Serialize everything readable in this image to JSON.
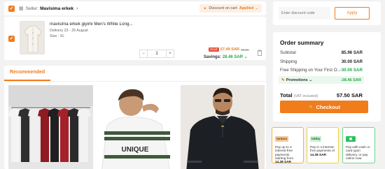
{
  "seller": {
    "label": "Seller:",
    "name": "Mavisima erkek",
    "discount_pill": {
      "text": "Discount on cart",
      "status": "Applied"
    }
  },
  "item": {
    "title": "mavisima erkek giyimi Men's White Long...",
    "delivery": "Delivery 23 - 25 August",
    "size": "Size : XL",
    "quantity": "1",
    "sale_badge": "SALE",
    "price_now": "57.49 SAR",
    "price_old": "85.96",
    "savings_label": "Savings:",
    "savings_value": "28.46 SAR"
  },
  "recommended": {
    "tab_label": "Recommended",
    "product3_print": "UNIQUE"
  },
  "coupon": {
    "placeholder": "Enter discount code",
    "apply_label": "Apply"
  },
  "summary": {
    "title": "Order summary",
    "rows": [
      {
        "label": "Subtotal",
        "value": "85.96 SAR"
      },
      {
        "label": "Shipping",
        "value": "30.00 SAR"
      },
      {
        "label": "Free Shipping on Your First O...",
        "value": "-30.00 SAR"
      }
    ],
    "promotions_label": "Promotions",
    "promotions_value": "-28.46 SAR",
    "total_label": "Total",
    "vat_label": "(VAT included)",
    "total_value": "57.50 SAR",
    "checkout_label": "Checkout"
  },
  "payments": [
    {
      "logo": "tamara",
      "text": "Pay up to 4 interest-free payments starting from",
      "amount": "14.38 SAR"
    },
    {
      "logo": "tabby",
      "text": "Pay in 4 interest-free payments of",
      "amount": "14.38 SAR"
    },
    {
      "logo": "",
      "text": "Pay with cash or card upon delivery, or pay online now.",
      "amount": ""
    }
  ],
  "colors": {
    "accent": "#f07c1c",
    "green": "#22aa4b",
    "sale_red": "#e74c3c"
  }
}
